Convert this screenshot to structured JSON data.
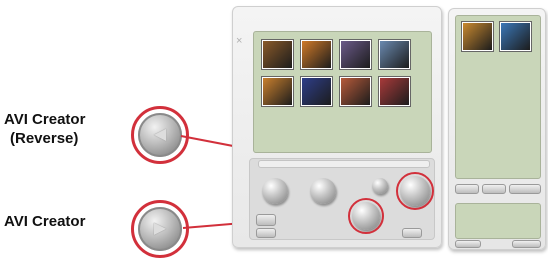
{
  "callouts": {
    "reverse": {
      "line1": "AVI Creator",
      "line2": "(Reverse)",
      "icon": "reverse-play-icon"
    },
    "forward": {
      "label": "AVI Creator",
      "icon": "play-icon"
    }
  },
  "main_panel": {
    "close_glyph": "×",
    "thumbnails": [
      {
        "name": "thumbnail-1",
        "color": "#8a5a2a"
      },
      {
        "name": "thumbnail-2",
        "color": "#d07a28"
      },
      {
        "name": "thumbnail-3",
        "color": "#6b5a8a"
      },
      {
        "name": "thumbnail-4",
        "color": "#6a8ab0"
      },
      {
        "name": "thumbnail-5",
        "color": "#c9802e"
      },
      {
        "name": "thumbnail-6",
        "color": "#2e3e8a"
      },
      {
        "name": "thumbnail-7",
        "color": "#b65a3a"
      },
      {
        "name": "thumbnail-8",
        "color": "#a83a3a"
      }
    ]
  },
  "side_panel": {
    "thumbnails": [
      {
        "name": "side-thumbnail-1",
        "color": "#c98a30"
      },
      {
        "name": "side-thumbnail-2",
        "color": "#3b78b8"
      }
    ]
  },
  "colors": {
    "highlight": "#d2303b",
    "screen": "#c9d6b9"
  }
}
